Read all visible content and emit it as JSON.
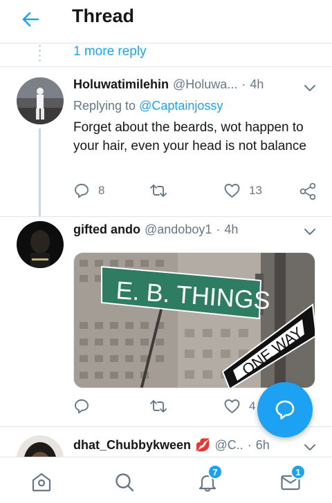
{
  "header": {
    "title": "Thread",
    "back_icon": "arrow-left-icon"
  },
  "thread": {
    "more_replies_label": "1 more reply"
  },
  "tweets": [
    {
      "name": "Holuwatimilehin",
      "handle": "@Holuwa...",
      "separator": "·",
      "time": "4h",
      "replying_prefix": "Replying to",
      "replying_to": "@Captainjossy",
      "text": "Forget about the beards, wot happen to your hair, even your head is not balance",
      "reply_count": "8",
      "retweet_count": "",
      "like_count": "13"
    },
    {
      "name": "gifted ando",
      "handle": "@andoboy1",
      "separator": "·",
      "time": "4h",
      "media": {
        "sign_top": "E. B. THINGS",
        "sign_bottom": "ONE WAY"
      },
      "reply_count": "",
      "retweet_count": "",
      "like_count": "4"
    },
    {
      "name": "dhat_Chubbykween",
      "emoji": "💋",
      "handle": "@C..",
      "separator": "·",
      "time": "6h"
    }
  ],
  "fab": {
    "icon": "compose-reply-icon"
  },
  "nav": {
    "items": [
      {
        "icon": "home-icon",
        "badge": ""
      },
      {
        "icon": "search-icon",
        "badge": ""
      },
      {
        "icon": "notifications-icon",
        "badge": "7"
      },
      {
        "icon": "messages-icon",
        "badge": "1"
      }
    ]
  },
  "colors": {
    "accent": "#1da1f2",
    "text": "#14171a",
    "muted": "#657786",
    "border": "#e1e8ed"
  }
}
